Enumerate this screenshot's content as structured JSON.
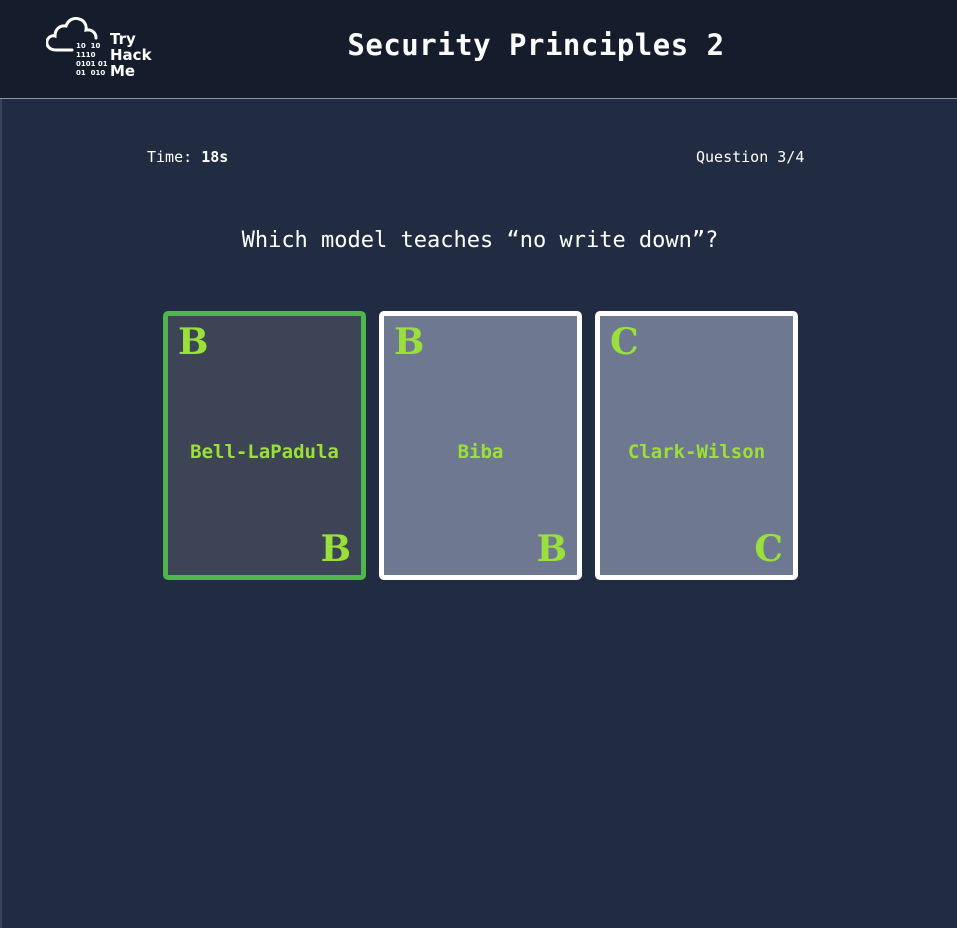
{
  "header": {
    "logo": {
      "word1": "Try",
      "word2": "Hack",
      "word3": "Me",
      "binary": "10  10\n1110\n0101 01\n01  010"
    },
    "title": "Security Principles 2"
  },
  "status": {
    "time_label": "Time:",
    "time_value": "18s",
    "question_counter": "Question 3/4"
  },
  "question": "Which model teaches “no write down”?",
  "cards": [
    {
      "letter": "B",
      "label": "Bell-LaPadula",
      "selected": true
    },
    {
      "letter": "B",
      "label": "Biba",
      "selected": false
    },
    {
      "letter": "C",
      "label": "Clark-Wilson",
      "selected": false
    }
  ],
  "colors": {
    "background": "#212c42",
    "header": "#151c2b",
    "card": "#6e7891",
    "card_selected": "#3d4455",
    "selected_border": "#4fb64d",
    "accent_text": "#9be03a"
  }
}
